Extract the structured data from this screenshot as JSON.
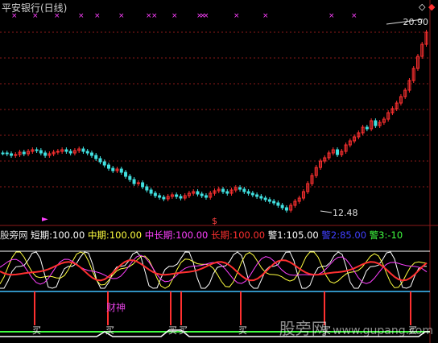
{
  "header": {
    "title": "平安银行(日线)"
  },
  "price_chart": {
    "high_label": "20.90",
    "low_label": "12.48",
    "marker_symbol": "$",
    "arrow_symbol": "►"
  },
  "indicator": {
    "name": "股旁网",
    "params": [
      {
        "label": "短期:",
        "value": "100.00",
        "color": "#ffffff"
      },
      {
        "label": "中期:",
        "value": "100.00",
        "color": "#ffff40"
      },
      {
        "label": "中长期:",
        "value": "100.00",
        "color": "#ff40ff"
      },
      {
        "label": "长期:",
        "value": "100.00",
        "color": "#ff3030"
      },
      {
        "label": "警1:",
        "value": "105.00",
        "color": "#ffffff"
      },
      {
        "label": "警2:",
        "value": "85.00",
        "color": "#4040ff"
      },
      {
        "label": "警3:",
        "value": "-10",
        "color": "#40ff40"
      }
    ],
    "signal_label": "财神",
    "buy_label": "买"
  },
  "watermark": {
    "text": "股旁网",
    "url": "www.gupang.com"
  },
  "colors": {
    "background": "#000000",
    "up_candle": "#ff3030",
    "down_candle": "#40e0e0",
    "grid": "#8b1a1a",
    "warn_line_1": "#ffffff",
    "warn_line_2": "#4040ff",
    "warn_line_3": "#40ff40",
    "cyan_line": "#40c0ff"
  }
}
